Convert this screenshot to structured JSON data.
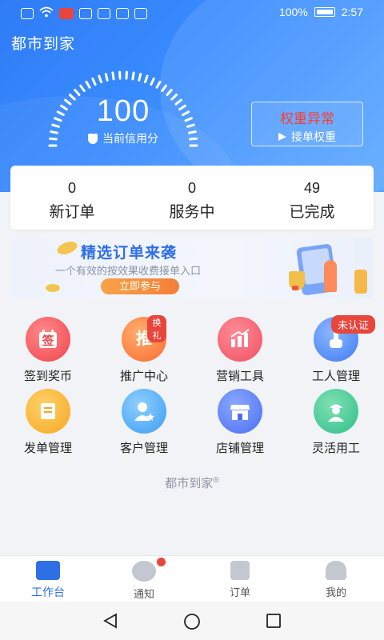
{
  "status_bar": {
    "battery": "100%",
    "time": "2:57"
  },
  "header": {
    "title": "都市到家"
  },
  "credit": {
    "score": "100",
    "label": "当前信用分"
  },
  "weight_box": {
    "warning": "权重异常",
    "action": "接单权重"
  },
  "stats": [
    {
      "value": "0",
      "label": "新订单"
    },
    {
      "value": "0",
      "label": "服务中"
    },
    {
      "value": "49",
      "label": "已完成"
    }
  ],
  "banner": {
    "headline": "精选订单来袭",
    "description": "一个有效的按效果收费接单入口",
    "cta": "立即参与"
  },
  "grid": [
    {
      "label": "签到奖币",
      "icon": "sign-in-icon",
      "glyph": "签",
      "color": "#f0444c"
    },
    {
      "label": "推广中心",
      "icon": "promotion-icon",
      "glyph": "推",
      "badge": "换礼",
      "color": "#ff6a2c"
    },
    {
      "label": "营销工具",
      "icon": "marketing-chart-icon",
      "color": "#ef4f63"
    },
    {
      "label": "工人管理",
      "icon": "worker-hand-icon",
      "badge": "未认证",
      "color": "#3f7bf2"
    },
    {
      "label": "发单管理",
      "icon": "order-dispatch-icon",
      "color": "#f5a623"
    },
    {
      "label": "客户管理",
      "icon": "customer-icon",
      "color": "#3b9cf5"
    },
    {
      "label": "店铺管理",
      "icon": "shop-icon",
      "color": "#4a6ef0"
    },
    {
      "label": "灵活用工",
      "icon": "flexible-worker-icon",
      "color": "#2fbf87"
    }
  ],
  "footer": {
    "brand": "都市到家",
    "mark": "®"
  },
  "tabs": [
    {
      "label": "工作台",
      "icon": "workbench-icon",
      "active": true
    },
    {
      "label": "通知",
      "icon": "notification-icon",
      "active": false
    },
    {
      "label": "订单",
      "icon": "order-list-icon",
      "active": false
    },
    {
      "label": "我的",
      "icon": "profile-icon",
      "active": false
    }
  ]
}
